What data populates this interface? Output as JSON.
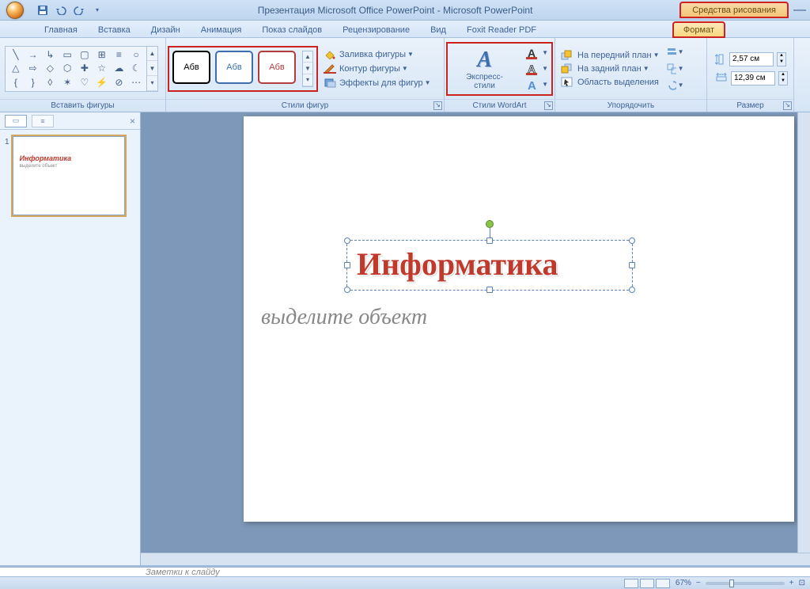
{
  "title": "Презентация Microsoft Office PowerPoint - Microsoft PowerPoint",
  "contextual_tab": "Средства рисования",
  "tabs": {
    "home": "Главная",
    "insert": "Вставка",
    "design": "Дизайн",
    "anim": "Анимация",
    "slideshow": "Показ слайдов",
    "review": "Рецензирование",
    "view": "Вид",
    "foxit": "Foxit Reader PDF",
    "format": "Формат"
  },
  "groups": {
    "insert_shapes": "Вставить фигуры",
    "shape_styles": "Стили фигур",
    "wordart_styles": "Стили WordArt",
    "arrange": "Упорядочить",
    "size": "Размер"
  },
  "shape_sample": "Абв",
  "shape_fx": {
    "fill": "Заливка фигуры",
    "outline": "Контур фигуры",
    "effects": "Эффекты для фигур"
  },
  "wordart": {
    "quick": "Экспресс-стили"
  },
  "arrange": {
    "front": "На передний план",
    "back": "На задний план",
    "selection": "Область выделения"
  },
  "size": {
    "height": "2,57 см",
    "width": "12,39 см"
  },
  "slide": {
    "title": "Информатика",
    "subtitle": "выделите объект"
  },
  "thumb": {
    "num": "1"
  },
  "notes_placeholder": "Заметки к слайду",
  "status": {
    "zoom": "67%"
  }
}
